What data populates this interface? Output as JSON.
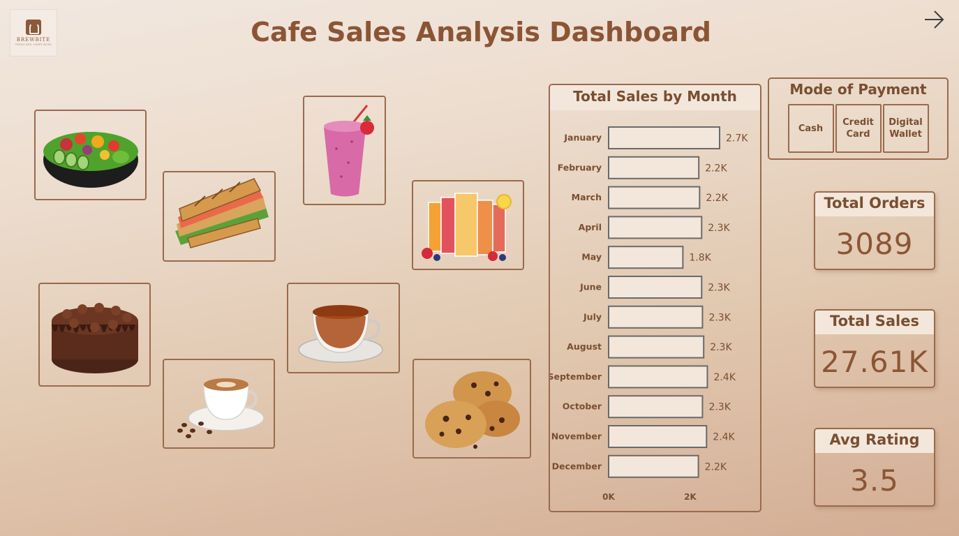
{
  "logo": {
    "name": "BREWBITE",
    "tagline": "FRESH SIPS, HAPPY BITES"
  },
  "header": {
    "title": "Cafe Sales Analysis Dashboard"
  },
  "nav": {
    "icon": "arrow-right-icon"
  },
  "gallery": [
    {
      "name": "salad-photo",
      "icon": "salad-bowl-icon"
    },
    {
      "name": "sandwich-photo",
      "icon": "sandwich-icon"
    },
    {
      "name": "smoothie-photo",
      "icon": "smoothie-icon"
    },
    {
      "name": "juices-photo",
      "icon": "juice-glasses-icon"
    },
    {
      "name": "cake-photo",
      "icon": "chocolate-cake-icon"
    },
    {
      "name": "tea-photo",
      "icon": "tea-cup-icon"
    },
    {
      "name": "coffee-photo",
      "icon": "coffee-cup-icon"
    },
    {
      "name": "cookies-photo",
      "icon": "cookies-icon"
    }
  ],
  "payment": {
    "title": "Mode of Payment",
    "options": [
      "Cash",
      "Credit Card",
      "Digital Wallet"
    ]
  },
  "kpis": {
    "orders": {
      "label": "Total Orders",
      "value": "3089"
    },
    "sales": {
      "label": "Total Sales",
      "value": "27.61K"
    },
    "rating": {
      "label": "Avg Rating",
      "value": "3.5"
    }
  },
  "colors": {
    "accent": "#8b5535",
    "border": "#9a6a4c",
    "bar_fill": "#f3e7db",
    "bar_stroke": "#6a6a6a"
  },
  "chart_data": {
    "type": "bar",
    "orientation": "horizontal",
    "title": "Total Sales by Month",
    "categories": [
      "January",
      "February",
      "March",
      "April",
      "May",
      "June",
      "July",
      "August",
      "September",
      "October",
      "November",
      "December"
    ],
    "values": [
      2720,
      2210,
      2230,
      2280,
      1820,
      2280,
      2300,
      2330,
      2420,
      2300,
      2400,
      2200
    ],
    "labels": [
      "2.7K",
      "2.2K",
      "2.2K",
      "2.3K",
      "1.8K",
      "2.3K",
      "2.3K",
      "2.3K",
      "2.4K",
      "2.3K",
      "2.4K",
      "2.2K"
    ],
    "xticks": [
      "0K",
      "2K"
    ],
    "xtick_values": [
      0,
      2000
    ],
    "xlim": [
      0,
      2720
    ],
    "grid": false,
    "legend": "none"
  }
}
